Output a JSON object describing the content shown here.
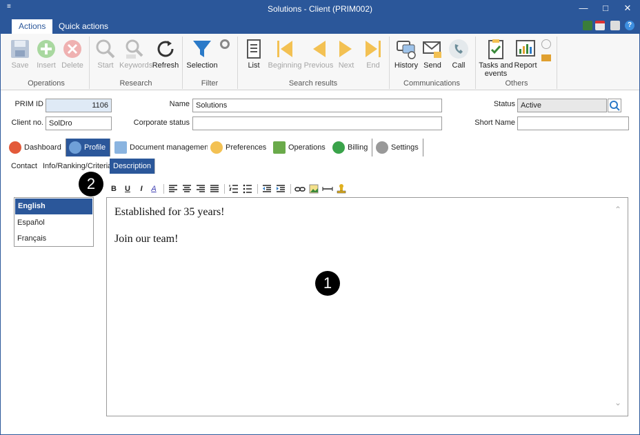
{
  "window": {
    "title": "Solutions - Client (PRIM002)",
    "sys_menu": "≡"
  },
  "window_controls": {
    "minimize": "—",
    "maximize": "□",
    "close": "✕"
  },
  "ribbon_tabs": [
    {
      "label": "Actions",
      "active": true
    },
    {
      "label": "Quick actions",
      "active": false
    }
  ],
  "ribbon": {
    "buttons": [
      {
        "label": "Save",
        "icon": "save-icon",
        "disabled": true
      },
      {
        "label": "Insert",
        "icon": "insert-icon",
        "disabled": true
      },
      {
        "label": "Delete",
        "icon": "delete-icon",
        "disabled": true
      },
      {
        "label": "Start",
        "icon": "search-icon",
        "disabled": true
      },
      {
        "label": "Keywords",
        "icon": "keywords-icon",
        "disabled": true
      },
      {
        "label": "Refresh",
        "icon": "refresh-icon",
        "disabled": false
      },
      {
        "label": "Selection",
        "icon": "filter-icon",
        "disabled": false
      },
      {
        "label": "List",
        "icon": "list-icon",
        "disabled": false
      },
      {
        "label": "Beginning",
        "icon": "first-icon",
        "disabled": true
      },
      {
        "label": "Previous",
        "icon": "previous-icon",
        "disabled": true
      },
      {
        "label": "Next",
        "icon": "next-icon",
        "disabled": true
      },
      {
        "label": "End",
        "icon": "last-icon",
        "disabled": true
      },
      {
        "label": "History",
        "icon": "history-icon",
        "disabled": false
      },
      {
        "label": "Send",
        "icon": "send-icon",
        "disabled": false
      },
      {
        "label": "Call",
        "icon": "call-icon",
        "disabled": false
      },
      {
        "label": "Tasks and events",
        "icon": "tasks-icon",
        "disabled": false
      },
      {
        "label": "Report",
        "icon": "report-icon",
        "disabled": false
      }
    ],
    "groups": [
      "Operations",
      "Research",
      "Filter",
      "Search results",
      "Communications",
      "Others"
    ]
  },
  "header": {
    "prim_id_label": "PRIM ID",
    "prim_id": "1106",
    "name_label": "Name",
    "name": "Solutions",
    "status_label": "Status",
    "status": "Active",
    "client_no_label": "Client no.",
    "client_no": "SolDro",
    "corporate_status_label": "Corporate status",
    "corporate_status": "",
    "short_name_label": "Short Name",
    "short_name": ""
  },
  "main_tabs": [
    {
      "label": "Dashboard",
      "active": false
    },
    {
      "label": "Profile",
      "active": true
    },
    {
      "label": "Document management",
      "active": false
    },
    {
      "label": "Preferences",
      "active": false
    },
    {
      "label": "Operations",
      "active": false
    },
    {
      "label": "Billing",
      "active": false
    },
    {
      "label": "Settings",
      "active": false
    }
  ],
  "sub_tabs": [
    {
      "label": "Contact",
      "active": false
    },
    {
      "label": "Info/Ranking/Criteria",
      "active": false
    },
    {
      "label": "Description",
      "active": true
    }
  ],
  "languages": [
    {
      "label": "English",
      "selected": true
    },
    {
      "label": "Español",
      "selected": false
    },
    {
      "label": "Français",
      "selected": false
    }
  ],
  "format_toolbar": {
    "bold": "B",
    "underline": "U",
    "italic": "I",
    "font_color": "A"
  },
  "editor": {
    "lines": [
      "Established for 35 years!",
      "Join our team!"
    ]
  },
  "callouts": [
    "1",
    "2"
  ],
  "colors": {
    "accent": "#2b579a",
    "ribbon_bg": "#f7f7f7"
  }
}
